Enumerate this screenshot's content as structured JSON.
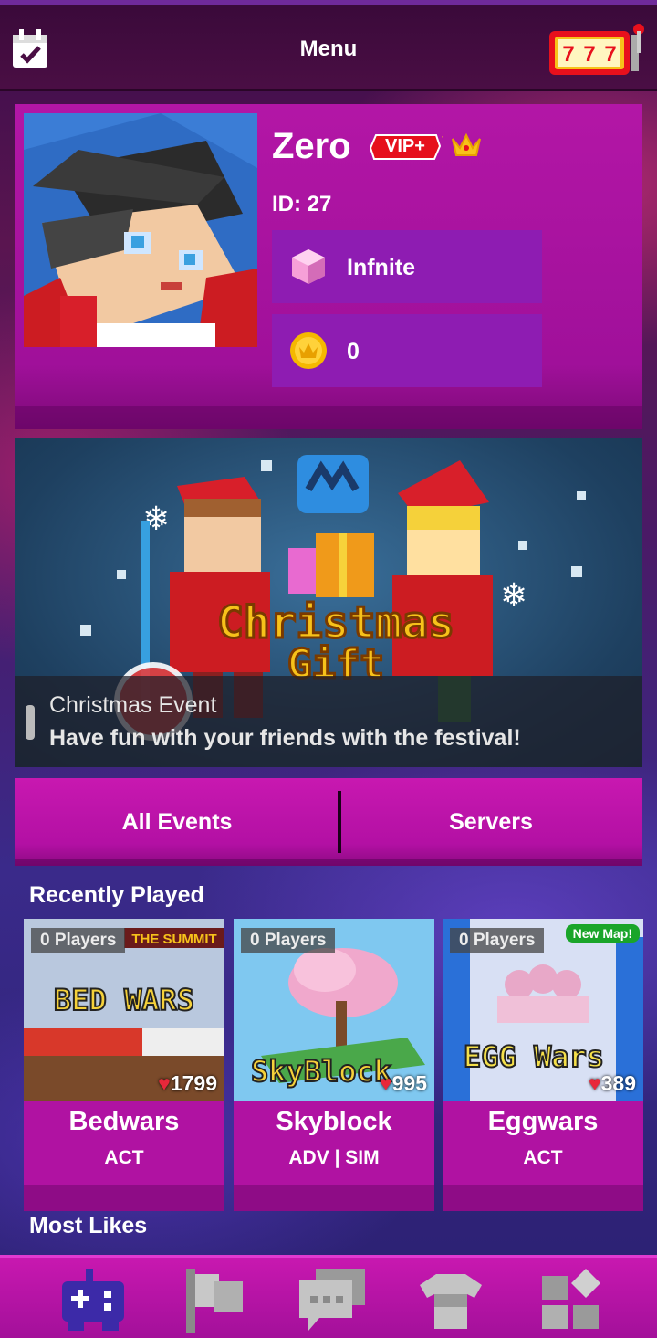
{
  "header": {
    "title": "Menu",
    "slot_label": "777"
  },
  "profile": {
    "username": "Zero",
    "vip_label": "VIP+",
    "id_text": "ID: 27",
    "gems_value": "Infnite",
    "gold_value": "0"
  },
  "banner": {
    "art_line1": "Christmas",
    "art_line2": "Gift",
    "title": "Christmas Event",
    "subtitle": "Have fun with your friends with the festival!"
  },
  "tabs": {
    "left": "All Events",
    "right": "Servers"
  },
  "recently_played": {
    "title": "Recently Played",
    "games": [
      {
        "players": "0 Players",
        "likes": "1799",
        "name": "Bedwars",
        "category": "ACT",
        "art": "BED WARS",
        "art_tag": "THE SUMMIT"
      },
      {
        "players": "0 Players",
        "likes": "995",
        "name": "Skyblock",
        "category": "ADV | SIM",
        "art": "SkyBlock"
      },
      {
        "players": "0 Players",
        "likes": "389",
        "name": "Eggwars",
        "category": "ACT",
        "art": "EGG Wars",
        "badge": "New Map!"
      }
    ]
  },
  "most_likes": {
    "title": "Most Likes"
  },
  "nav": [
    {
      "icon": "gamepad-icon"
    },
    {
      "icon": "flag-icon"
    },
    {
      "icon": "chat-icon"
    },
    {
      "icon": "shirt-icon"
    },
    {
      "icon": "blocks-icon"
    }
  ],
  "colors": {
    "accent": "#b012a2",
    "panel": "#8e1cb2",
    "heart": "#e8283a",
    "nav_active": "#3c2aa8"
  }
}
